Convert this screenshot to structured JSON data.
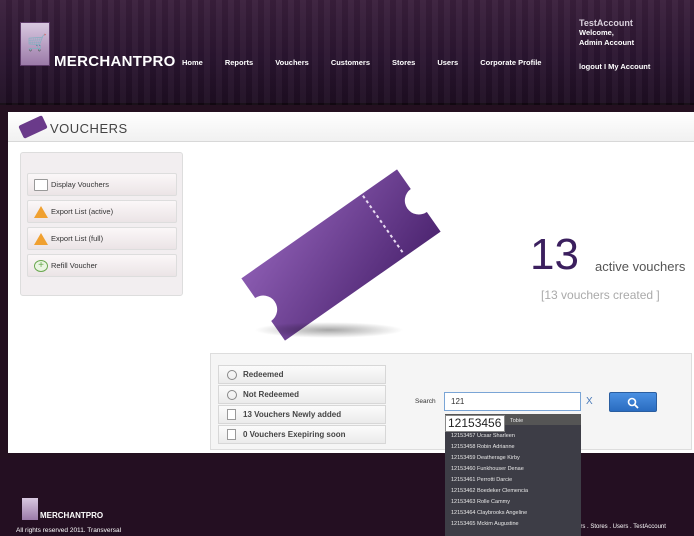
{
  "header": {
    "brand": "MERCHANTPRO",
    "nav": [
      "Home",
      "Reports",
      "Vouchers",
      "Customers",
      "Stores",
      "Users",
      "Corporate Profile"
    ],
    "account_name": "TestAccount",
    "welcome": "Welcome,",
    "admin": "Admin Account",
    "links": "logout I My Account"
  },
  "page": {
    "title": "VOUCHERS"
  },
  "menu": [
    {
      "label": "Display Vouchers",
      "icon": "folder-icon"
    },
    {
      "label": "Export List (active)",
      "icon": "warning-icon"
    },
    {
      "label": "Export List (full)",
      "icon": "warning-icon"
    },
    {
      "label": "Refill Voucher",
      "icon": "plus-icon"
    }
  ],
  "stats": {
    "count": "13",
    "label": "active vouchers",
    "created": "[13 vouchers created ]"
  },
  "filters": [
    {
      "label": "Redeemed",
      "icon": "download-icon"
    },
    {
      "label": "Not Redeemed",
      "icon": "download-icon"
    },
    {
      "label": "13 Vouchers Newly added",
      "icon": "document-icon"
    },
    {
      "label": "0 Vouchers Exepiring soon",
      "icon": "document-icon"
    }
  ],
  "search": {
    "label": "Search",
    "value": "121",
    "clear": "X",
    "button_icon": "search-icon"
  },
  "autocomplete": {
    "highlight": "12153456",
    "first_name": "Tobie",
    "rows": [
      "12153457 Ucsar Sharleen",
      "12153458 Robin Adrianne",
      "12153459 Deatherage Kirby",
      "12153460 Funkhouser Denae",
      "12153461 Perrotti Darcie",
      "12153462 Boedeker Clemencia",
      "12153463 Rolle Cammy",
      "12153464 Claybrooks Angeline",
      "12153465 Mckim Augustine"
    ]
  },
  "footer": {
    "brand": "MERCHANTPRO",
    "copyright": "All rights reserved 2011. Transversal",
    "links": "ers . Stores . Users . TestAccount"
  },
  "colors": {
    "brand_purple": "#5b2d7a",
    "header_bg": "#2a1530",
    "search_blue": "#2a6cc0"
  }
}
